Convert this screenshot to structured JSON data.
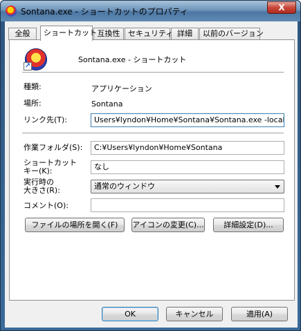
{
  "window": {
    "title": "Sontana.exe - ショートカットのプロパティ",
    "close_label": "X"
  },
  "tabs": [
    {
      "label": "全般"
    },
    {
      "label": "ショートカット"
    },
    {
      "label": "互換性"
    },
    {
      "label": "セキュリティ"
    },
    {
      "label": "詳細"
    },
    {
      "label": "以前のバージョン"
    }
  ],
  "header": {
    "name": "Sontana.exe - ショートカット"
  },
  "fields": {
    "type_label": "種類:",
    "type_value": "アプリケーション",
    "location_label": "場所:",
    "location_value": "Sontana",
    "target_label": "リンク先(T):",
    "target_value": "Users¥lyndon¥Home¥Sontana¥Sontana.exe -locale th",
    "start_in_label": "作業フォルダ(S):",
    "start_in_value": "C:¥Users¥lyndon¥Home¥Sontana",
    "hotkey_label_line1": "ショートカット",
    "hotkey_label_line2": "キー(K):",
    "hotkey_value": "なし",
    "run_label_line1": "実行時の",
    "run_label_line2": "大きさ(R):",
    "run_value": "通常のウィンドウ",
    "comment_label": "コメント(O):",
    "comment_value": ""
  },
  "buttons": {
    "open_location": "ファイルの場所を開く(F)",
    "change_icon": "アイコンの変更(C)...",
    "advanced": "詳細設定(D)...",
    "ok": "OK",
    "cancel": "キャンセル",
    "apply": "適用(A)"
  }
}
